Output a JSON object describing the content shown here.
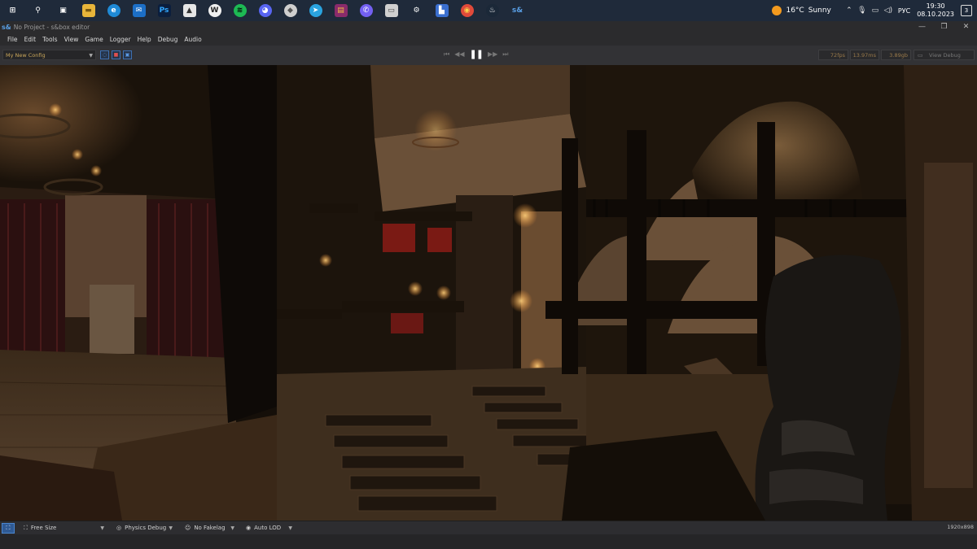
{
  "taskbar": {
    "apps": [
      {
        "name": "windows-start-icon",
        "glyph": "⊞",
        "bg": "transparent",
        "fg": "#ffffff"
      },
      {
        "name": "search-icon",
        "glyph": "⚲",
        "bg": "transparent",
        "fg": "#ffffff"
      },
      {
        "name": "task-view-icon",
        "glyph": "▣",
        "bg": "transparent",
        "fg": "#ffffff"
      },
      {
        "name": "file-explorer-icon",
        "glyph": "▬",
        "bg": "#e8b53a",
        "fg": "#7a5a10"
      },
      {
        "name": "edge-icon",
        "glyph": "e",
        "bg": "#1f8ad6",
        "fg": "#ffffff",
        "round": true
      },
      {
        "name": "mail-icon",
        "glyph": "✉",
        "bg": "#1c6fc7",
        "fg": "#ffffff"
      },
      {
        "name": "photoshop-icon",
        "glyph": "Ps",
        "bg": "#0b1e3d",
        "fg": "#31a8ff"
      },
      {
        "name": "image-viewer-icon",
        "glyph": "▲",
        "bg": "#e6e6e6",
        "fg": "#333333"
      },
      {
        "name": "app-w-icon",
        "glyph": "W",
        "bg": "#f0f0f0",
        "fg": "#222222",
        "round": true
      },
      {
        "name": "spotify-icon",
        "glyph": "≋",
        "bg": "#1db954",
        "fg": "#000000",
        "round": true
      },
      {
        "name": "discord-icon",
        "glyph": "◕",
        "bg": "#5865f2",
        "fg": "#ffffff",
        "round": true
      },
      {
        "name": "vpn-shield-icon",
        "glyph": "◆",
        "bg": "#cfcfcf",
        "fg": "#555555",
        "round": true
      },
      {
        "name": "telegram-icon",
        "glyph": "➤",
        "bg": "#2aa3df",
        "fg": "#ffffff",
        "round": true
      },
      {
        "name": "winrar-icon",
        "glyph": "▤",
        "bg": "#8a2b6b",
        "fg": "#f0c040"
      },
      {
        "name": "viber-icon",
        "glyph": "✆",
        "bg": "#7360f2",
        "fg": "#ffffff",
        "round": true
      },
      {
        "name": "printer-icon",
        "glyph": "▭",
        "bg": "#d0d0d0",
        "fg": "#444444"
      },
      {
        "name": "settings-gear-icon",
        "glyph": "⚙",
        "bg": "transparent",
        "fg": "#ffffff"
      },
      {
        "name": "remote-desktop-icon",
        "glyph": "▙",
        "bg": "#3a6fd0",
        "fg": "#ffffff"
      },
      {
        "name": "chrome-icon",
        "glyph": "◉",
        "bg": "#e04a3a",
        "fg": "#f7d34a",
        "round": true
      },
      {
        "name": "steam-icon",
        "glyph": "♨",
        "bg": "#1b2838",
        "fg": "#ffffff",
        "round": true
      },
      {
        "name": "sbox-icon",
        "glyph": "s&",
        "bg": "transparent",
        "fg": "#5aa0e6"
      }
    ],
    "badges": {
      "discord": "",
      "telegram": ""
    },
    "weather": {
      "temp": "16°C",
      "condition": "Sunny"
    },
    "language": "РУС",
    "time": "19:30",
    "date": "08.10.2023",
    "notifications": "3"
  },
  "window": {
    "logo": "s&",
    "title": "No Project - s&box editor",
    "minimize": "—",
    "restore": "❐",
    "close": "✕"
  },
  "menu": [
    "File",
    "Edit",
    "Tools",
    "View",
    "Game",
    "Logger",
    "Help",
    "Debug",
    "Audio"
  ],
  "toolbar": {
    "config": "My New Config",
    "stats": {
      "fps": "72fps",
      "frametime": "13.97ms",
      "memory": "3.89gb"
    },
    "view_debug": "View Debug"
  },
  "bottom": {
    "size_mode": "Free Size",
    "physics": "Physics Debug",
    "fakelag": "No Fakelag",
    "lod": "Auto LOD",
    "resolution": "1920x898"
  }
}
